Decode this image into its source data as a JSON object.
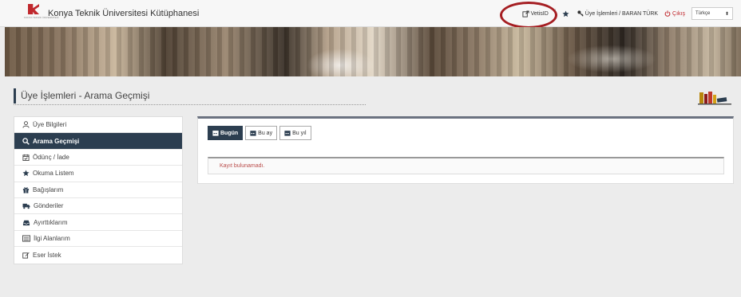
{
  "header": {
    "logo_icon": "konya-university-logo-icon",
    "logo_subtext": "KONYA TEKNİK ÜNİVERSİTESİ",
    "title": "Konya Teknik Üniversitesi Kütüphanesi",
    "vetis_label": "VetisID",
    "favorites_icon": "star-icon",
    "member_label": "Üye İşlemleri / BARAN TÜRK",
    "logout_label": "Çıkış",
    "language_value": "Türkçe"
  },
  "page": {
    "title": "Üye İşlemleri - Arama Geçmişi"
  },
  "sidebar": {
    "items": [
      {
        "label": "Üye Bilgileri",
        "icon": "user-icon",
        "active": false
      },
      {
        "label": "Arama Geçmişi",
        "icon": "search-icon",
        "active": true
      },
      {
        "label": "Ödünç / İade",
        "icon": "calendar-check-icon",
        "active": false
      },
      {
        "label": "Okuma Listem",
        "icon": "star-icon",
        "active": false
      },
      {
        "label": "Bağışlarım",
        "icon": "gift-icon",
        "active": false
      },
      {
        "label": "Gönderiler",
        "icon": "truck-icon",
        "active": false
      },
      {
        "label": "Ayırttıklarım",
        "icon": "inbox-icon",
        "active": false
      },
      {
        "label": "İlgi Alanlarım",
        "icon": "list-icon",
        "active": false
      },
      {
        "label": "Eser İstek",
        "icon": "edit-icon",
        "active": false
      }
    ]
  },
  "filters": {
    "today": "Bugün",
    "this_month": "Bu ay",
    "this_year": "Bu yıl",
    "active": "today"
  },
  "results": {
    "empty_message": "Kayıt bulunamadı."
  },
  "colors": {
    "accent": "#2c3e50",
    "danger": "#c0282d",
    "highlight_ring": "#a51e22"
  }
}
